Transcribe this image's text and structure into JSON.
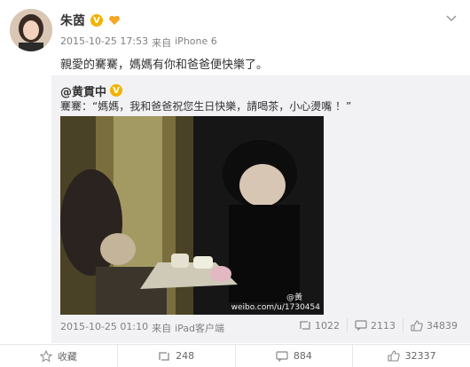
{
  "post": {
    "author": "朱茵",
    "time": "2015-10-25 17:53",
    "from_label": "来自",
    "device": "iPhone 6",
    "text": "親愛的騫騫，媽媽有你和爸爸便快樂了。"
  },
  "repost": {
    "user": "@黄貫中",
    "text": "騫騫：“媽媽，我和爸爸祝您生日快樂，請喝茶，小心燙嘴 ！”",
    "watermark": "weibo.com/u/1730454",
    "watermark_logo": "@黃",
    "time": "2015-10-25 01:10",
    "from_label": "来自",
    "device": "iPad客户端",
    "reposts": "1022",
    "comments": "2113",
    "likes": "34839"
  },
  "footer": {
    "favorite": "收藏",
    "repost": "248",
    "comment": "884",
    "like": "32337"
  },
  "colors": {
    "badge": "#f2b200",
    "repost_bg": "#f2f2f5",
    "meta": "#808080"
  },
  "icons": [
    "vip-badge-icon",
    "heart-badge-icon",
    "chevron-down-icon",
    "repost-icon",
    "comment-icon",
    "like-icon",
    "star-icon"
  ]
}
